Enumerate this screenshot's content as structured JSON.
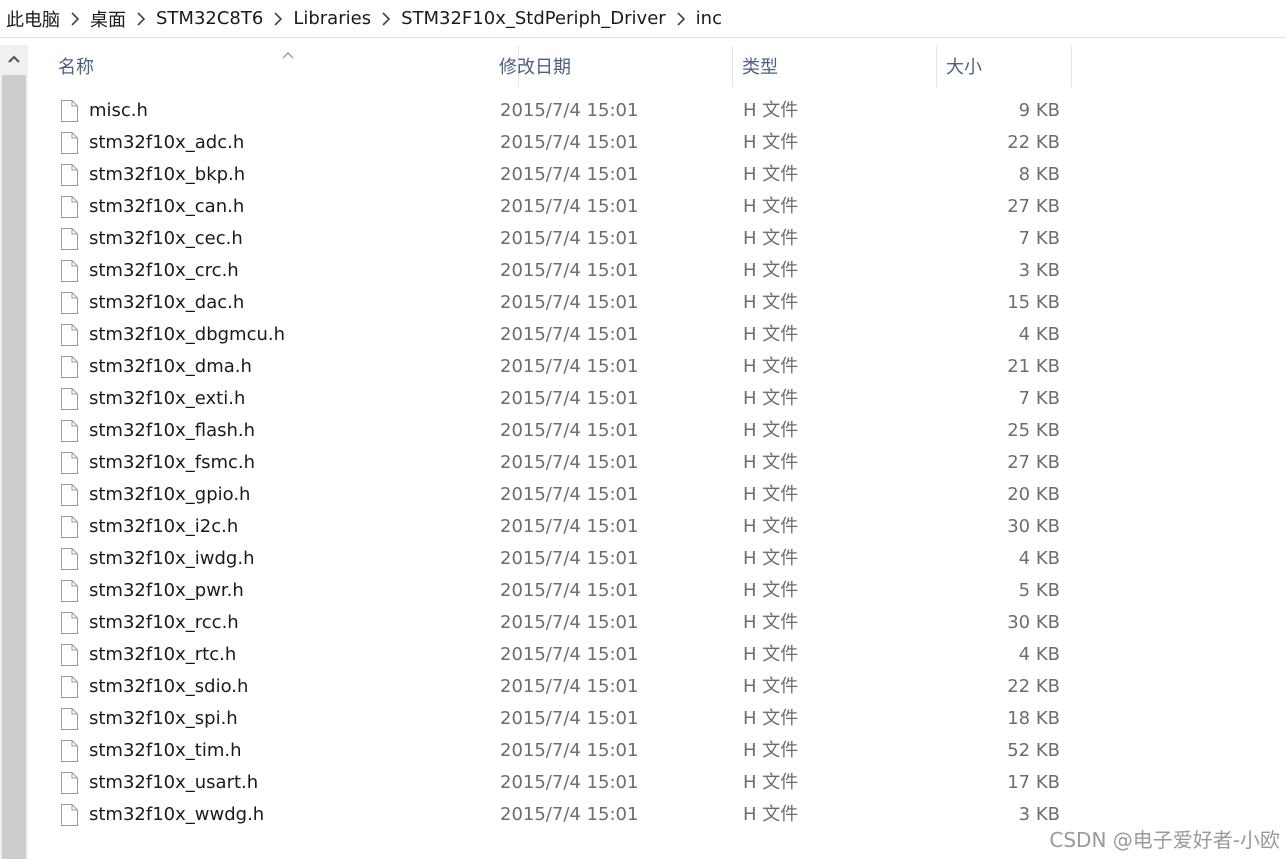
{
  "breadcrumb": [
    "此电脑",
    "桌面",
    "STM32C8T6",
    "Libraries",
    "STM32F10x_StdPeriph_Driver",
    "inc"
  ],
  "columns": {
    "name": "名称",
    "date": "修改日期",
    "type": "类型",
    "size": "大小"
  },
  "files": [
    {
      "name": "misc.h",
      "date": "2015/7/4 15:01",
      "type": "H 文件",
      "size": "9 KB"
    },
    {
      "name": "stm32f10x_adc.h",
      "date": "2015/7/4 15:01",
      "type": "H 文件",
      "size": "22 KB"
    },
    {
      "name": "stm32f10x_bkp.h",
      "date": "2015/7/4 15:01",
      "type": "H 文件",
      "size": "8 KB"
    },
    {
      "name": "stm32f10x_can.h",
      "date": "2015/7/4 15:01",
      "type": "H 文件",
      "size": "27 KB"
    },
    {
      "name": "stm32f10x_cec.h",
      "date": "2015/7/4 15:01",
      "type": "H 文件",
      "size": "7 KB"
    },
    {
      "name": "stm32f10x_crc.h",
      "date": "2015/7/4 15:01",
      "type": "H 文件",
      "size": "3 KB"
    },
    {
      "name": "stm32f10x_dac.h",
      "date": "2015/7/4 15:01",
      "type": "H 文件",
      "size": "15 KB"
    },
    {
      "name": "stm32f10x_dbgmcu.h",
      "date": "2015/7/4 15:01",
      "type": "H 文件",
      "size": "4 KB"
    },
    {
      "name": "stm32f10x_dma.h",
      "date": "2015/7/4 15:01",
      "type": "H 文件",
      "size": "21 KB"
    },
    {
      "name": "stm32f10x_exti.h",
      "date": "2015/7/4 15:01",
      "type": "H 文件",
      "size": "7 KB"
    },
    {
      "name": "stm32f10x_flash.h",
      "date": "2015/7/4 15:01",
      "type": "H 文件",
      "size": "25 KB"
    },
    {
      "name": "stm32f10x_fsmc.h",
      "date": "2015/7/4 15:01",
      "type": "H 文件",
      "size": "27 KB"
    },
    {
      "name": "stm32f10x_gpio.h",
      "date": "2015/7/4 15:01",
      "type": "H 文件",
      "size": "20 KB"
    },
    {
      "name": "stm32f10x_i2c.h",
      "date": "2015/7/4 15:01",
      "type": "H 文件",
      "size": "30 KB"
    },
    {
      "name": "stm32f10x_iwdg.h",
      "date": "2015/7/4 15:01",
      "type": "H 文件",
      "size": "4 KB"
    },
    {
      "name": "stm32f10x_pwr.h",
      "date": "2015/7/4 15:01",
      "type": "H 文件",
      "size": "5 KB"
    },
    {
      "name": "stm32f10x_rcc.h",
      "date": "2015/7/4 15:01",
      "type": "H 文件",
      "size": "30 KB"
    },
    {
      "name": "stm32f10x_rtc.h",
      "date": "2015/7/4 15:01",
      "type": "H 文件",
      "size": "4 KB"
    },
    {
      "name": "stm32f10x_sdio.h",
      "date": "2015/7/4 15:01",
      "type": "H 文件",
      "size": "22 KB"
    },
    {
      "name": "stm32f10x_spi.h",
      "date": "2015/7/4 15:01",
      "type": "H 文件",
      "size": "18 KB"
    },
    {
      "name": "stm32f10x_tim.h",
      "date": "2015/7/4 15:01",
      "type": "H 文件",
      "size": "52 KB"
    },
    {
      "name": "stm32f10x_usart.h",
      "date": "2015/7/4 15:01",
      "type": "H 文件",
      "size": "17 KB"
    },
    {
      "name": "stm32f10x_wwdg.h",
      "date": "2015/7/4 15:01",
      "type": "H 文件",
      "size": "3 KB"
    }
  ],
  "watermark": "CSDN @电子爱好者-小欧",
  "icons": {
    "breadcrumb_separator": "chevron-right-icon",
    "sort": "sort-ascending-icon",
    "file": "file-icon",
    "scroll_up": "scroll-up-arrow-icon"
  }
}
